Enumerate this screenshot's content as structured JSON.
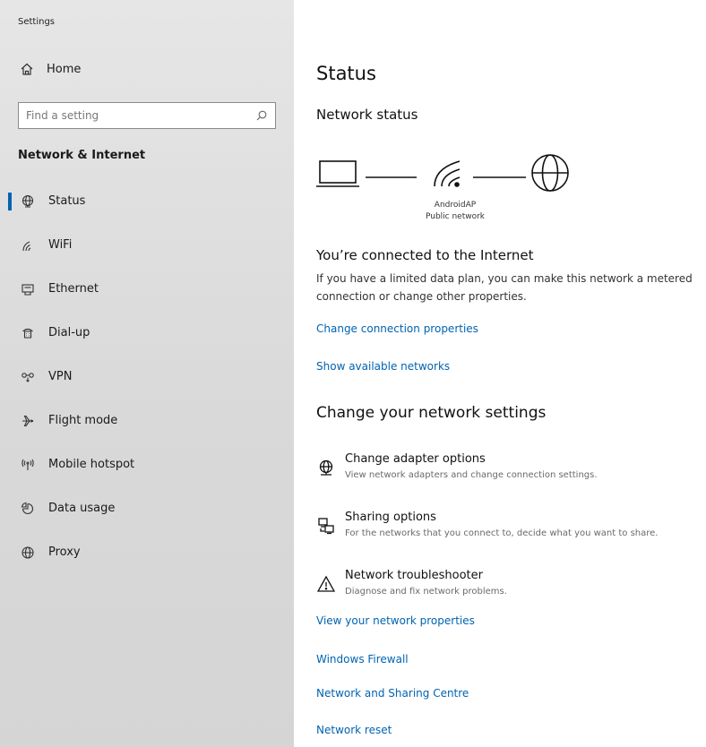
{
  "app": {
    "title": "Settings"
  },
  "sidebar": {
    "home_label": "Home",
    "search_placeholder": "Find a setting",
    "section_title": "Network & Internet",
    "items": [
      {
        "label": "Status",
        "icon": "globe-network-icon",
        "active": true
      },
      {
        "label": "WiFi",
        "icon": "wifi-icon",
        "active": false
      },
      {
        "label": "Ethernet",
        "icon": "ethernet-icon",
        "active": false
      },
      {
        "label": "Dial-up",
        "icon": "dial-up-icon",
        "active": false
      },
      {
        "label": "VPN",
        "icon": "vpn-icon",
        "active": false
      },
      {
        "label": "Flight mode",
        "icon": "airplane-icon",
        "active": false
      },
      {
        "label": "Mobile hotspot",
        "icon": "hotspot-icon",
        "active": false
      },
      {
        "label": "Data usage",
        "icon": "data-usage-icon",
        "active": false
      },
      {
        "label": "Proxy",
        "icon": "globe-icon",
        "active": false
      }
    ]
  },
  "main": {
    "title": "Status",
    "network_status_heading": "Network status",
    "network_name": "AndroidAP",
    "network_type": "Public network",
    "connected_title": "You’re connected to the Internet",
    "connected_desc": "If you have a limited data plan, you can make this network a metered connection or change other properties.",
    "links_top": [
      "Change connection properties",
      "Show available networks"
    ],
    "change_heading": "Change your network settings",
    "options": [
      {
        "title": "Change adapter options",
        "desc": "View network adapters and change connection settings.",
        "icon": "adapter-icon"
      },
      {
        "title": "Sharing options",
        "desc": "For the networks that you connect to, decide what you want to share.",
        "icon": "sharing-icon"
      },
      {
        "title": "Network troubleshooter",
        "desc": "Diagnose and fix network problems.",
        "icon": "warning-icon"
      }
    ],
    "links_bottom": [
      "View your network properties",
      "Windows Firewall",
      "Network and Sharing Centre",
      "Network reset"
    ]
  },
  "colors": {
    "accent": "#0063b1",
    "sidebar_bg": "#dcdcdc",
    "link": "#0063b1"
  }
}
